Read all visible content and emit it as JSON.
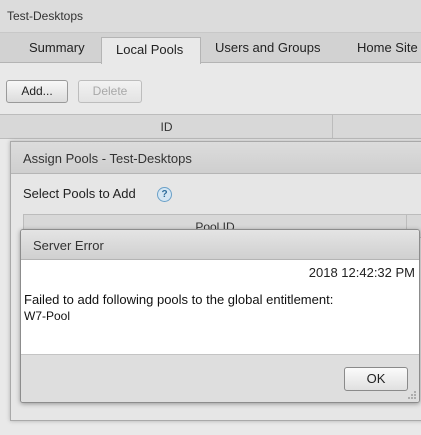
{
  "window": {
    "title": "Test-Desktops"
  },
  "tabs": [
    {
      "label": "Summary"
    },
    {
      "label": "Local Pools"
    },
    {
      "label": "Users and Groups"
    },
    {
      "label": "Home Site"
    }
  ],
  "toolbar": {
    "add_label": "Add...",
    "delete_label": "Delete"
  },
  "grid": {
    "id_header": "ID"
  },
  "assign_dialog": {
    "title": "Assign Pools - Test-Desktops",
    "subtitle": "Select Pools to Add",
    "help_glyph": "?",
    "pool_id_header": "Pool ID"
  },
  "error_dialog": {
    "title": "Server Error",
    "timestamp": "2018 12:42:32 PM",
    "message": "Failed to add following pools to the global entitlement:",
    "pool": "W7-Pool",
    "ok_label": "OK"
  },
  "colors": {
    "accent_help": "#2f6d9b",
    "dialog_bg": "#ffffff",
    "footer_bg": "#dedede"
  }
}
